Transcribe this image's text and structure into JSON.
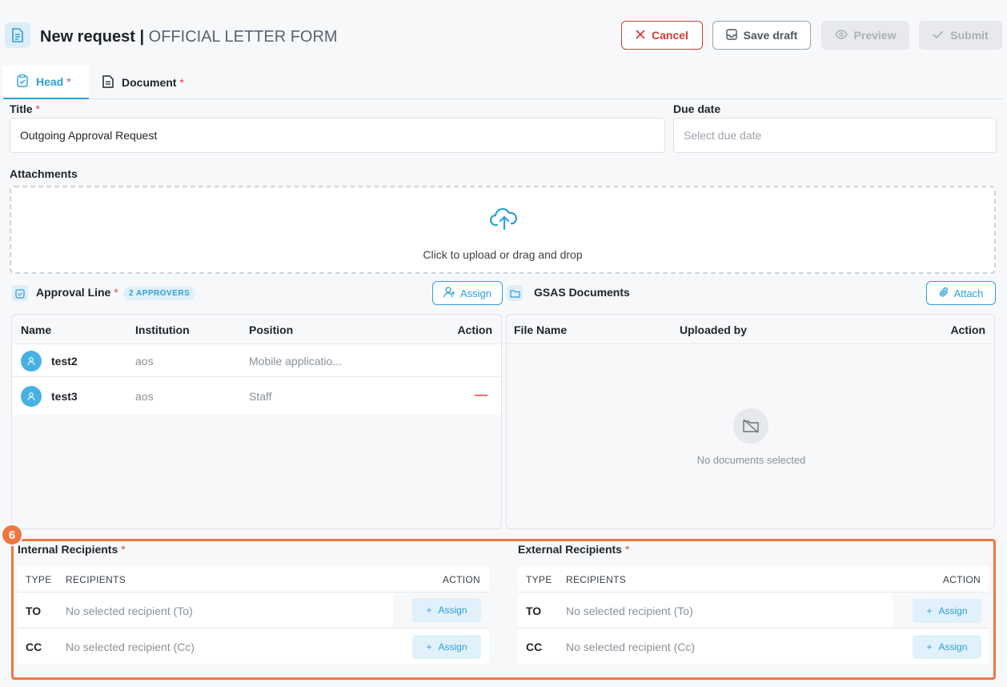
{
  "header": {
    "title_main": "New request",
    "title_sep": " | ",
    "title_sub": "OFFICIAL LETTER FORM",
    "buttons": {
      "cancel": "Cancel",
      "save_draft": "Save draft",
      "preview": "Preview",
      "submit": "Submit"
    }
  },
  "tabs": [
    {
      "label": "Head",
      "required": "*",
      "active": true
    },
    {
      "label": "Document",
      "required": "*",
      "active": false
    }
  ],
  "form": {
    "title_label": "Title",
    "title_required": "*",
    "title_value": "Outgoing Approval Request",
    "due_date_label": "Due date",
    "due_date_placeholder": "Select due date",
    "attachments_label": "Attachments",
    "upload_text": "Click to upload or drag and drop"
  },
  "approval": {
    "title": "Approval Line",
    "required": "*",
    "badge": "2 APPROVERS",
    "assign_label": "Assign",
    "columns": [
      "Name",
      "Institution",
      "Position",
      "Action"
    ],
    "rows": [
      {
        "name": "test2",
        "institution": "aos",
        "position": "Mobile applicatio...",
        "action": ""
      },
      {
        "name": "test3",
        "institution": "aos",
        "position": "Staff",
        "action": "—"
      }
    ]
  },
  "gsas": {
    "title": "GSAS Documents",
    "attach_label": "Attach",
    "columns": [
      "File Name",
      "Uploaded by",
      "Action"
    ],
    "empty_text": "No documents selected"
  },
  "step_badge": "6",
  "internal": {
    "title": "Internal Recipients",
    "required": "*",
    "columns": [
      "TYPE",
      "RECIPIENTS",
      "ACTION"
    ],
    "rows": [
      {
        "type": "TO",
        "recipient": "No selected recipient (To)",
        "action": "Assign"
      },
      {
        "type": "CC",
        "recipient": "No selected recipient (Cc)",
        "action": "Assign"
      }
    ]
  },
  "external": {
    "title": "External Recipients",
    "required": "*",
    "columns": [
      "TYPE",
      "RECIPIENTS",
      "ACTION"
    ],
    "rows": [
      {
        "type": "TO",
        "recipient": "No selected recipient (To)",
        "action": "Assign"
      },
      {
        "type": "CC",
        "recipient": "No selected recipient (Cc)",
        "action": "Assign"
      }
    ]
  },
  "colors": {
    "accent": "#2ea0d6",
    "danger": "#d63b3b",
    "highlight": "#ef7540"
  }
}
